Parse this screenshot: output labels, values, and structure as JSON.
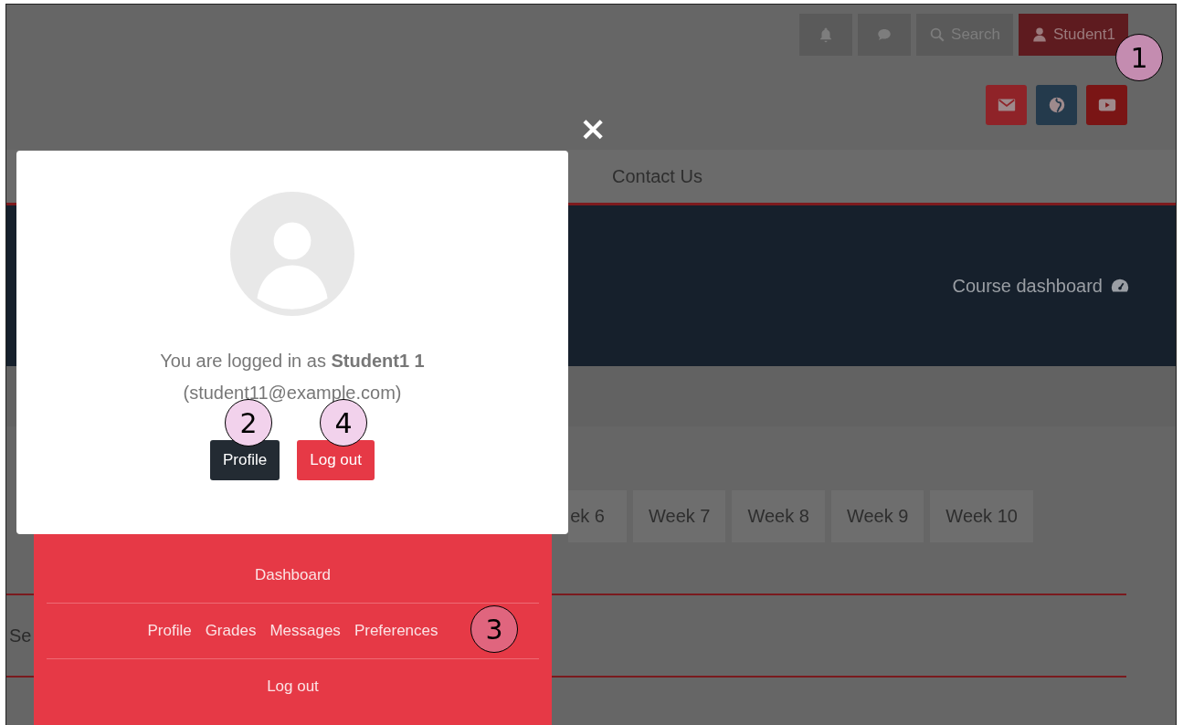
{
  "toolbar": {
    "buttons": [
      {
        "kind": "bell"
      },
      {
        "kind": "chat"
      },
      {
        "kind": "search",
        "label": "Search"
      },
      {
        "kind": "user",
        "label": "Student1"
      }
    ]
  },
  "social": [
    {
      "kind": "mail",
      "color": "#8f2328"
    },
    {
      "kind": "globe",
      "color": "#243a4c"
    },
    {
      "kind": "video",
      "color": "#7a1515"
    }
  ],
  "close": {
    "label": "×"
  },
  "nav": {
    "items": [
      "Contact Us"
    ]
  },
  "hero": {
    "link": "Course dashboard"
  },
  "week_tabs": {
    "items": [
      "ek 6",
      "Week 7",
      "Week 8",
      "Week 9",
      "Week 10"
    ]
  },
  "section": {
    "cut_text": "Se"
  },
  "modal": {
    "text": "You are logged in as **Student1 1**",
    "email": "(student11@example.com)",
    "buttons": [
      {
        "label": "Profile",
        "kind": "dark"
      },
      {
        "label": "Log out",
        "kind": "danger"
      }
    ]
  },
  "user_menu": {
    "top": "Dashboard",
    "links": [
      "Profile",
      "Grades",
      "Messages",
      "Preferences"
    ],
    "bottom": "Log out"
  },
  "callouts": [
    {
      "label": "1",
      "color": "#c48cb0"
    },
    {
      "label": "2",
      "color": "#f2d2ec"
    },
    {
      "label": "3",
      "color": "#e0657e"
    },
    {
      "label": "4",
      "color": "#f2d2ec"
    }
  ]
}
